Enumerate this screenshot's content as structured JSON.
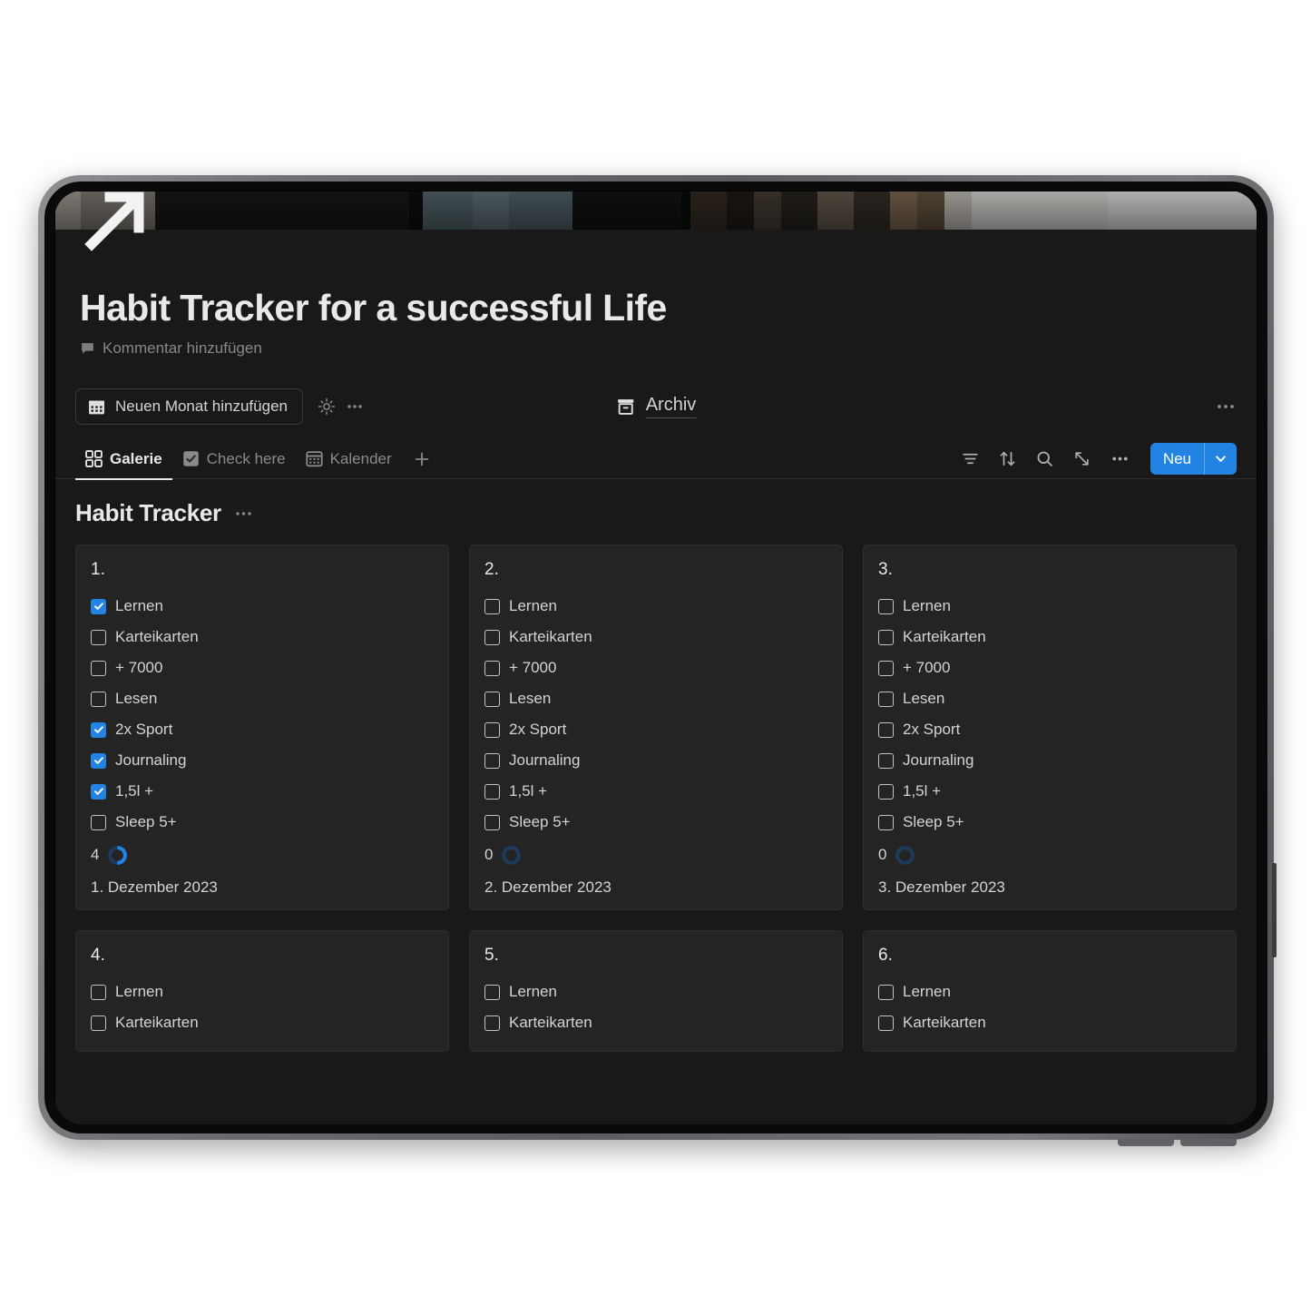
{
  "page": {
    "title": "Habit Tracker for a successful Life",
    "comment_placeholder": "Kommentar hinzufügen"
  },
  "action_row": {
    "add_month_label": "Neuen Monat hinzufügen",
    "archive_label": "Archiv",
    "more_label": "•••"
  },
  "tabs": [
    {
      "label": "Galerie",
      "icon": "gallery-grid-icon",
      "active": true
    },
    {
      "label": "Check here",
      "icon": "checkbox-icon",
      "active": false
    },
    {
      "label": "Kalender",
      "icon": "calendar-icon",
      "active": false
    }
  ],
  "tab_tools": {
    "filter": "filter-icon",
    "sort": "sort-icon",
    "search": "search-icon",
    "expand": "expand-icon",
    "more": "more-icon",
    "new_label": "Neu",
    "new_dropdown": "chevron-down-icon"
  },
  "section": {
    "title": "Habit Tracker",
    "more_label": "•••"
  },
  "colors": {
    "accent_blue": "#2383E2",
    "page_background": "#191919",
    "card_background": "#242424",
    "text_primary": "#e9e9e7",
    "text_secondary": "#d4d4d2",
    "text_muted": "#888886"
  },
  "habit_names": [
    "Lernen",
    "Karteikarten",
    "+ 7000",
    "Lesen",
    "2x Sport",
    "Journaling",
    "1,5l +",
    "Sleep 5+"
  ],
  "cards": [
    {
      "number": "1.",
      "date": "1. Dezember 2023",
      "count": "4",
      "progress_percent": 50,
      "habits": [
        {
          "label": "Lernen",
          "checked": true
        },
        {
          "label": "Karteikarten",
          "checked": false
        },
        {
          "label": "+ 7000",
          "checked": false
        },
        {
          "label": "Lesen",
          "checked": false
        },
        {
          "label": "2x Sport",
          "checked": true
        },
        {
          "label": "Journaling",
          "checked": true
        },
        {
          "label": "1,5l +",
          "checked": true
        },
        {
          "label": "Sleep 5+",
          "checked": false
        }
      ]
    },
    {
      "number": "2.",
      "date": "2. Dezember 2023",
      "count": "0",
      "progress_percent": 0,
      "habits": [
        {
          "label": "Lernen",
          "checked": false
        },
        {
          "label": "Karteikarten",
          "checked": false
        },
        {
          "label": "+ 7000",
          "checked": false
        },
        {
          "label": "Lesen",
          "checked": false
        },
        {
          "label": "2x Sport",
          "checked": false
        },
        {
          "label": "Journaling",
          "checked": false
        },
        {
          "label": "1,5l +",
          "checked": false
        },
        {
          "label": "Sleep 5+",
          "checked": false
        }
      ]
    },
    {
      "number": "3.",
      "date": "3. Dezember 2023",
      "count": "0",
      "progress_percent": 0,
      "habits": [
        {
          "label": "Lernen",
          "checked": false
        },
        {
          "label": "Karteikarten",
          "checked": false
        },
        {
          "label": "+ 7000",
          "checked": false
        },
        {
          "label": "Lesen",
          "checked": false
        },
        {
          "label": "2x Sport",
          "checked": false
        },
        {
          "label": "Journaling",
          "checked": false
        },
        {
          "label": "1,5l +",
          "checked": false
        },
        {
          "label": "Sleep 5+",
          "checked": false
        }
      ]
    },
    {
      "number": "4.",
      "date": "",
      "count": "",
      "progress_percent": 0,
      "habits": [
        {
          "label": "Lernen",
          "checked": false
        },
        {
          "label": "Karteikarten",
          "checked": false
        }
      ]
    },
    {
      "number": "5.",
      "date": "",
      "count": "",
      "progress_percent": 0,
      "habits": [
        {
          "label": "Lernen",
          "checked": false
        },
        {
          "label": "Karteikarten",
          "checked": false
        }
      ]
    },
    {
      "number": "6.",
      "date": "",
      "count": "",
      "progress_percent": 0,
      "habits": [
        {
          "label": "Lernen",
          "checked": false
        },
        {
          "label": "Karteikarten",
          "checked": false
        }
      ]
    }
  ]
}
